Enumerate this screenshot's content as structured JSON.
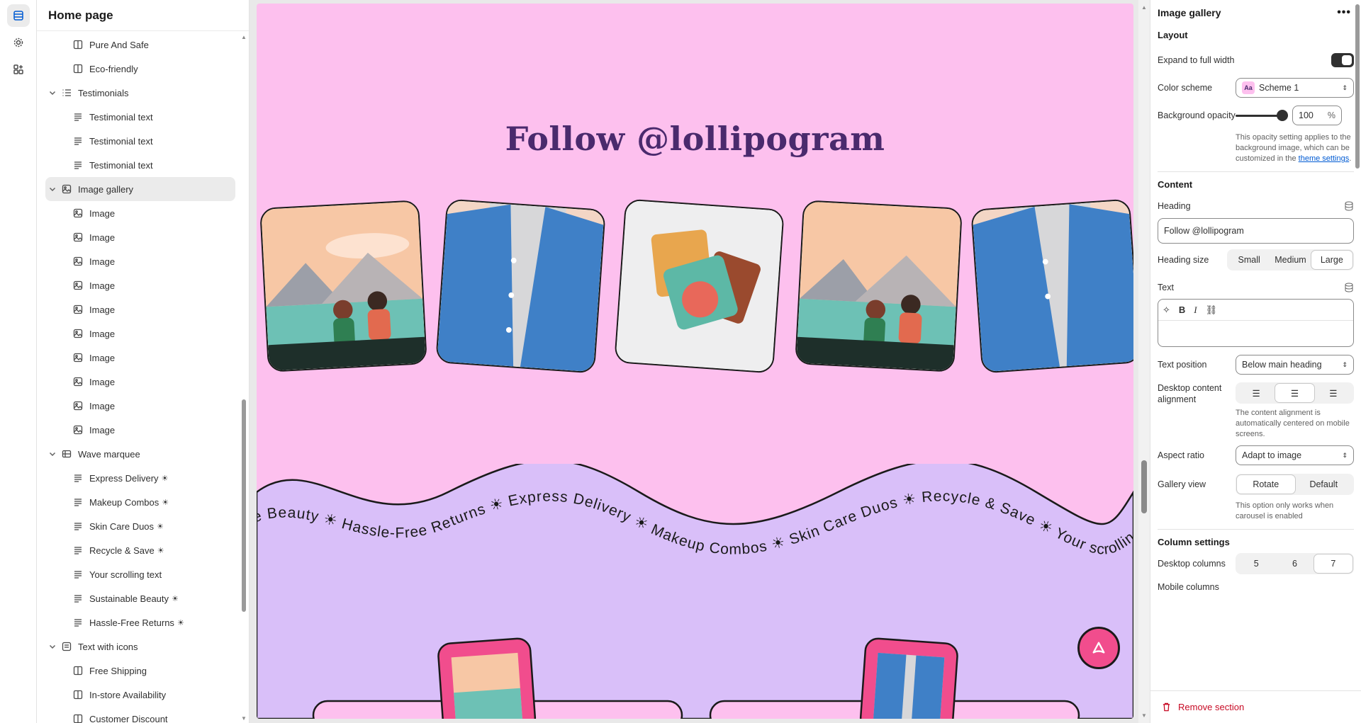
{
  "sidebar": {
    "title": "Home page",
    "items": [
      {
        "type": "block",
        "label": "Pure And Safe",
        "icon": "column-icon"
      },
      {
        "type": "block",
        "label": "Eco-friendly",
        "icon": "column-icon"
      },
      {
        "type": "section",
        "label": "Testimonials",
        "icon": "list-icon"
      },
      {
        "type": "block",
        "label": "Testimonial text",
        "icon": "text-icon"
      },
      {
        "type": "block",
        "label": "Testimonial text",
        "icon": "text-icon"
      },
      {
        "type": "block",
        "label": "Testimonial text",
        "icon": "text-icon"
      },
      {
        "type": "section",
        "label": "Image gallery",
        "icon": "image-icon",
        "selected": true
      },
      {
        "type": "block",
        "label": "Image",
        "icon": "image-icon"
      },
      {
        "type": "block",
        "label": "Image",
        "icon": "image-icon"
      },
      {
        "type": "block",
        "label": "Image",
        "icon": "image-icon"
      },
      {
        "type": "block",
        "label": "Image",
        "icon": "image-icon"
      },
      {
        "type": "block",
        "label": "Image",
        "icon": "image-icon"
      },
      {
        "type": "block",
        "label": "Image",
        "icon": "image-icon"
      },
      {
        "type": "block",
        "label": "Image",
        "icon": "image-icon"
      },
      {
        "type": "block",
        "label": "Image",
        "icon": "image-icon"
      },
      {
        "type": "block",
        "label": "Image",
        "icon": "image-icon"
      },
      {
        "type": "block",
        "label": "Image",
        "icon": "image-icon"
      },
      {
        "type": "section",
        "label": "Wave marquee",
        "icon": "marquee-icon"
      },
      {
        "type": "block",
        "label": "Express Delivery",
        "icon": "text-icon",
        "spark": true
      },
      {
        "type": "block",
        "label": "Makeup Combos",
        "icon": "text-icon",
        "spark": true
      },
      {
        "type": "block",
        "label": "Skin Care Duos",
        "icon": "text-icon",
        "spark": true
      },
      {
        "type": "block",
        "label": "Recycle & Save",
        "icon": "text-icon",
        "spark": true
      },
      {
        "type": "block",
        "label": "Your scrolling text",
        "icon": "text-icon"
      },
      {
        "type": "block",
        "label": "Sustainable Beauty",
        "icon": "text-icon",
        "spark": true
      },
      {
        "type": "block",
        "label": "Hassle-Free Returns",
        "icon": "text-icon",
        "spark": true
      },
      {
        "type": "section",
        "label": "Text with icons",
        "icon": "text-box-icon"
      },
      {
        "type": "block",
        "label": "Free Shipping",
        "icon": "column-icon"
      },
      {
        "type": "block",
        "label": "In-store Availability",
        "icon": "column-icon"
      },
      {
        "type": "block",
        "label": "Customer Discount",
        "icon": "column-icon"
      }
    ]
  },
  "preview": {
    "heading": "Follow @lollipogram",
    "marquee": "ble Beauty ☀ Hassle-Free Returns ☀ Express Delivery ☀ Makeup Combos ☀ Skin Care Duos ☀ Recycle & Save ☀ Your scrolling text ☀ Sustainable Beauty ☀ Hassle-Free Returns",
    "colors": {
      "background": "#fdc0ee",
      "heading": "#4a2a6d",
      "wave": "#d9bff9",
      "accent": "#f14d8d"
    }
  },
  "settings": {
    "title": "Image gallery",
    "layout_title": "Layout",
    "expand_label": "Expand to full width",
    "color_scheme_label": "Color scheme",
    "color_scheme_badge": "Aa",
    "color_scheme_value": "Scheme 1",
    "bg_opacity_label": "Background opacity",
    "bg_opacity_value": "100",
    "bg_opacity_unit": "%",
    "bg_opacity_fraction": 1.0,
    "bg_opacity_help": "This opacity setting applies to the background image, which can be customized in the",
    "bg_opacity_link": "theme settings",
    "content_title": "Content",
    "heading_label": "Heading",
    "heading_value": "Follow @lollipogram",
    "heading_size_label": "Heading size",
    "heading_sizes": [
      "Small",
      "Medium",
      "Large"
    ],
    "heading_size_selected": "Large",
    "text_label": "Text",
    "text_position_label": "Text position",
    "text_position_value": "Below main heading",
    "alignment_label": "Desktop content alignment",
    "alignment_help": "The content alignment is automatically centered on mobile screens.",
    "aspect_label": "Aspect ratio",
    "aspect_value": "Adapt to image",
    "gallery_view_label": "Gallery view",
    "gallery_views": [
      "Rotate",
      "Default"
    ],
    "gallery_view_selected": "Rotate",
    "gallery_view_help": "This option only works when carousel is enabled",
    "column_title": "Column settings",
    "desktop_columns_label": "Desktop columns",
    "desktop_columns": [
      "5",
      "6",
      "7"
    ],
    "desktop_columns_selected": "7",
    "mobile_columns_label": "Mobile columns",
    "remove_label": "Remove section"
  }
}
